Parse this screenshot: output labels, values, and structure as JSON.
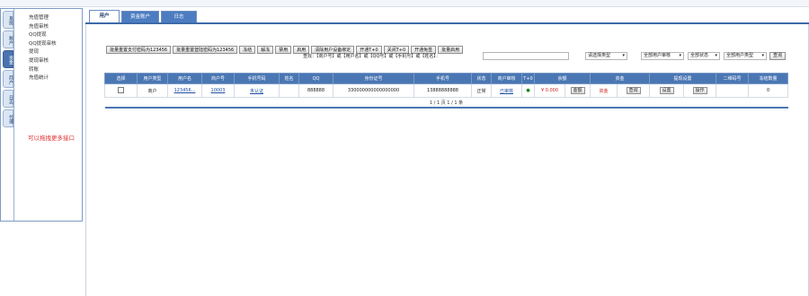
{
  "left": {
    "vtabs": [
      "系统",
      "账户",
      "资金",
      "商户",
      "日志",
      "代理"
    ],
    "active_vtab": 2,
    "menu": [
      "充值管理",
      "充值审核",
      "QQ提现",
      "QQ提现审核",
      "提现",
      "提现审核",
      "转账",
      "充值统计"
    ],
    "hint": "可以拖拽更多接口"
  },
  "tabs": [
    "用户",
    "资金账户",
    "日志"
  ],
  "toolbar": {
    "buttons": [
      "批量重置支付密码为123456",
      "批量重置登陆密码为123456",
      "冻结",
      "解冻",
      "禁用",
      "启用",
      "删除",
      "清除用户设备绑定",
      "开通T+0",
      "关闭T+0",
      "开通免签",
      "批量启用"
    ]
  },
  "search": {
    "label": "查找：【商户号】或【用户名】或【QQ号】或【手机号】或【姓名】：",
    "input_value": "",
    "select_type": "请选择类型",
    "select_audit": "全部用户审核",
    "select_status": "全部状态",
    "select_user_type": "全部用户类型",
    "query_btn": "查询"
  },
  "table": {
    "headers": [
      "选择",
      "用户类型",
      "用户名",
      "商户号",
      "手机号码",
      "姓名",
      "QQ",
      "身份证号",
      "手机号",
      "状态",
      "商户审核",
      "T+0",
      "余额",
      "",
      "资金",
      "",
      "提现设置",
      "",
      "二维码号",
      "冻结数量"
    ],
    "row": {
      "user_type": "商户",
      "username": "123456...",
      "merchant_no": "10003",
      "phone_status": "未认证",
      "name": "",
      "qq": "888888",
      "id_no": "330000000000000000",
      "mobile": "13888888888",
      "status": "正常",
      "audit": "已审核",
      "t0": "●",
      "balance": "¥ 0.000",
      "balance_btn": "金额",
      "funds": "资金",
      "funds_btn": "查询",
      "withdraw_btn1": "设置",
      "withdraw_btn2": "操作",
      "qrcode": "",
      "frozen": "0"
    },
    "pager": "1 / 1 页  1 / 1 条"
  }
}
